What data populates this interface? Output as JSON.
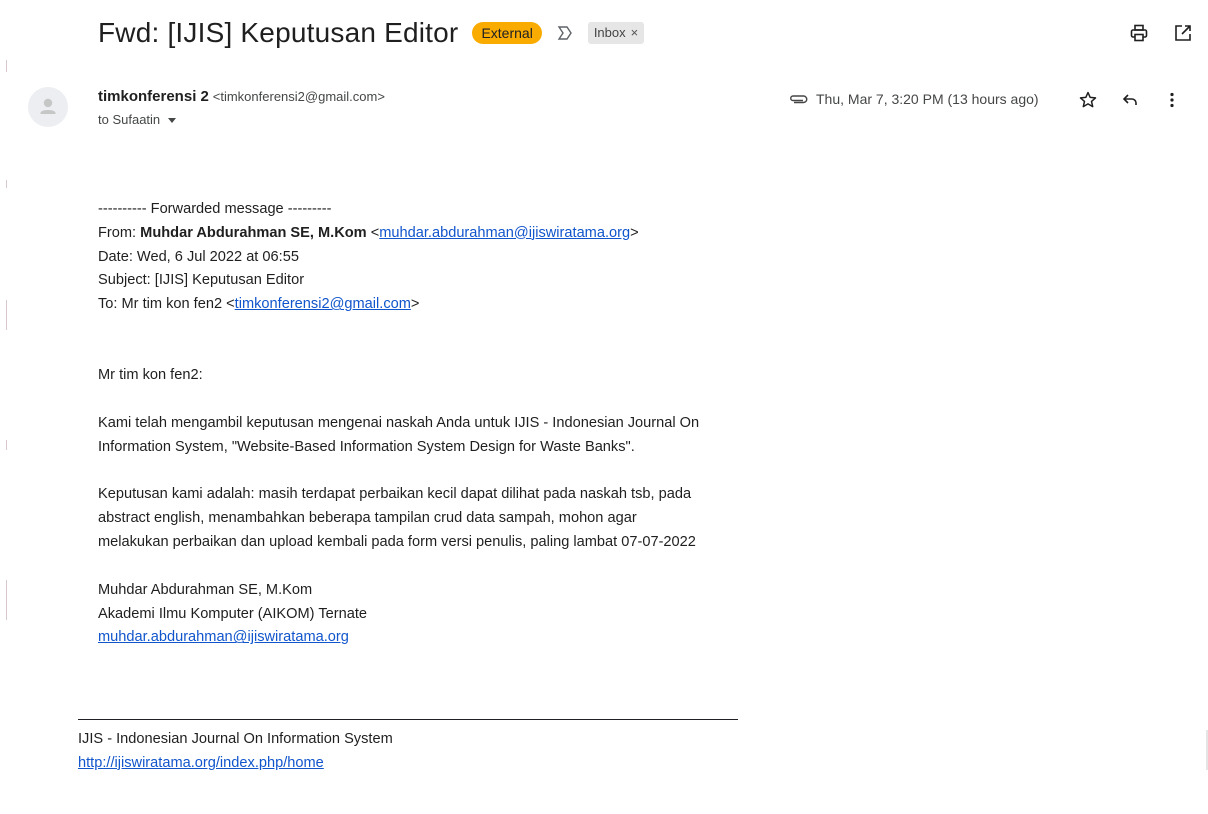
{
  "header": {
    "subject": "Fwd: [IJIS] Keputusan Editor",
    "external_badge": "External",
    "label_chip": "Inbox",
    "label_remove": "×",
    "colors": {
      "external_badge": "#f9ab00",
      "label_chip": "#e6e6e6",
      "link": "#1155cc"
    },
    "icons": [
      "important-marker-icon",
      "print-icon",
      "open-in-new-window-icon"
    ]
  },
  "sender": {
    "name": "timkonferensi 2",
    "email": "<timkonferensi2@gmail.com>",
    "to": "to Sufaatin",
    "date": "Thu, Mar 7, 3:20 PM (13 hours ago)",
    "icons": [
      "avatar-person-icon",
      "attachment-icon",
      "star-icon",
      "reply-icon",
      "more-vert-icon"
    ]
  },
  "body": {
    "forward_header": "---------- Forwarded message ---------",
    "from_label": "From: ",
    "from_name": "Muhdar Abdurahman SE, M.Kom",
    "from_open": " <",
    "from_email": "muhdar.abdurahman@ijiswiratama.org",
    "from_close": ">",
    "date_line": "Date: Wed, 6 Jul 2022 at 06:55",
    "subject_line": "Subject: [IJIS] Keputusan Editor",
    "to_label": "To: Mr tim kon fen2 <",
    "to_email": "timkonferensi2@gmail.com",
    "to_close": ">",
    "greeting": "Mr tim kon fen2:",
    "paragraph1": "Kami telah mengambil keputusan mengenai naskah Anda untuk IJIS - Indonesian Journal On Information System, \"Website-Based Information System Design for Waste Banks\".",
    "paragraph2": "Keputusan kami adalah: masih terdapat perbaikan kecil dapat dilihat pada naskah tsb, pada abstract english, menambahkan beberapa tampilan crud data sampah, mohon agar melakukan perbaikan dan upload kembali pada form versi penulis, paling lambat 07-07-2022",
    "signature_name": "Muhdar Abdurahman SE, M.Kom",
    "signature_org": "Akademi Ilmu Komputer (AIKOM) Ternate",
    "signature_email": "muhdar.abdurahman@ijiswiratama.org"
  },
  "footer": {
    "journal": "IJIS - Indonesian Journal On Information System",
    "url": "http://ijiswiratama.org/index.php/home"
  }
}
